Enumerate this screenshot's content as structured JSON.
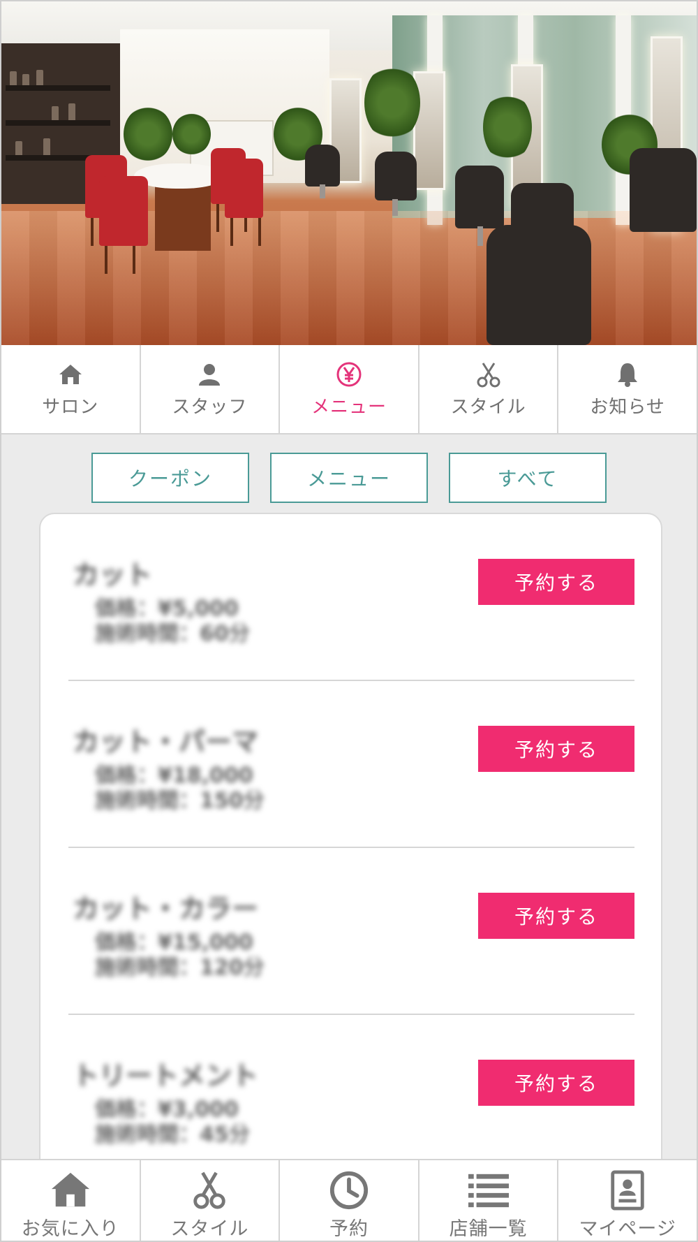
{
  "hero": {
    "icon": "salon-interior-photo"
  },
  "top_tabs": [
    {
      "label": "サロン",
      "icon": "home-icon",
      "active": false
    },
    {
      "label": "スタッフ",
      "icon": "person-icon",
      "active": false
    },
    {
      "label": "メニュー",
      "icon": "yen-icon",
      "active": true
    },
    {
      "label": "スタイル",
      "icon": "scissors-icon",
      "active": false
    },
    {
      "label": "お知らせ",
      "icon": "bell-icon",
      "active": false
    }
  ],
  "filters": [
    {
      "label": "クーポン"
    },
    {
      "label": "メニュー"
    },
    {
      "label": "すべて"
    }
  ],
  "menu_items": [
    {
      "name": "カット",
      "price": "価格：¥5,000",
      "time": "施術時間：60分",
      "button": "予約する"
    },
    {
      "name": "カット・パーマ",
      "price": "価格：¥18,000",
      "time": "施術時間：150分",
      "button": "予約する"
    },
    {
      "name": "カット・カラー",
      "price": "価格：¥15,000",
      "time": "施術時間：120分",
      "button": "予約する"
    },
    {
      "name": "トリートメント",
      "price": "価格：¥3,000",
      "time": "施術時間：45分",
      "button": "予約する"
    }
  ],
  "bottom_nav": [
    {
      "label": "お気に入り",
      "icon": "home-icon"
    },
    {
      "label": "スタイル",
      "icon": "scissors-icon"
    },
    {
      "label": "予約",
      "icon": "clock-icon"
    },
    {
      "label": "店舗一覧",
      "icon": "list-icon"
    },
    {
      "label": "マイページ",
      "icon": "profile-card-icon"
    }
  ],
  "colors": {
    "accent_pink": "#f02c70",
    "active_tab_pink": "#e4337a",
    "teal": "#4a9a96",
    "inactive_gray": "#707070",
    "background": "#ebebeb"
  }
}
